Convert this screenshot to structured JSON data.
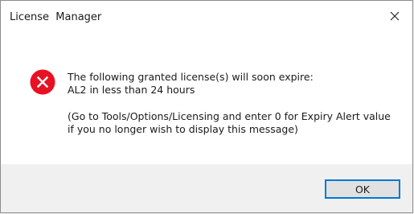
{
  "window": {
    "title": "License  Manager",
    "close_icon": "close-icon"
  },
  "message": {
    "icon": "error-icon",
    "icon_color": "#e81123",
    "line1": "The following granted license(s) will soon expire:",
    "line2": "AL2 in less than 24 hours",
    "line3": "(Go to Tools/Options/Licensing and enter 0 for Expiry Alert value",
    "line4": "if you no longer wish to display this message)"
  },
  "buttons": {
    "ok_label": "OK"
  },
  "colors": {
    "accent": "#0078d7",
    "footer_bg": "#f0f0f0"
  }
}
